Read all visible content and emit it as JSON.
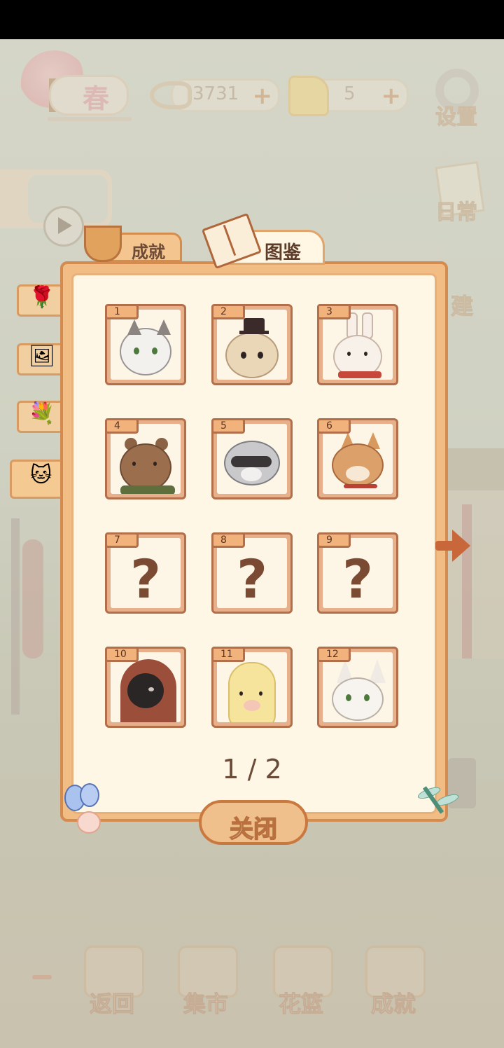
{
  "hud": {
    "season_label": "春",
    "fish_count": "3731",
    "cheese_count": "5",
    "plus": "+",
    "settings_label": "设置",
    "daily_label": "日常",
    "build_label": "建"
  },
  "tabs": {
    "achievements_label": "成就",
    "collection_label": "图鉴"
  },
  "side_tabs": [
    {
      "name": "flower-tab",
      "emoji": "🌹"
    },
    {
      "name": "photo-tab",
      "emoji": "🖼"
    },
    {
      "name": "bouquet-tab",
      "emoji": "💐"
    },
    {
      "name": "animal-tab",
      "emoji": "🐱"
    }
  ],
  "cards": [
    {
      "num": "1",
      "kind": "cat"
    },
    {
      "num": "2",
      "kind": "mouse"
    },
    {
      "num": "3",
      "kind": "rabbit"
    },
    {
      "num": "4",
      "kind": "bear"
    },
    {
      "num": "5",
      "kind": "raccoon"
    },
    {
      "num": "6",
      "kind": "shiba"
    },
    {
      "num": "7",
      "kind": "unknown",
      "mark": "?"
    },
    {
      "num": "8",
      "kind": "unknown",
      "mark": "?"
    },
    {
      "num": "9",
      "kind": "unknown",
      "mark": "?"
    },
    {
      "num": "10",
      "kind": "crow"
    },
    {
      "num": "11",
      "kind": "alpaca"
    },
    {
      "num": "12",
      "kind": "fox"
    }
  ],
  "pager": "1 / 2",
  "close_label": "关闭",
  "bottom_nav": [
    {
      "label": "返回"
    },
    {
      "label": "集市"
    },
    {
      "label": "花篮"
    },
    {
      "label": "成就"
    }
  ]
}
